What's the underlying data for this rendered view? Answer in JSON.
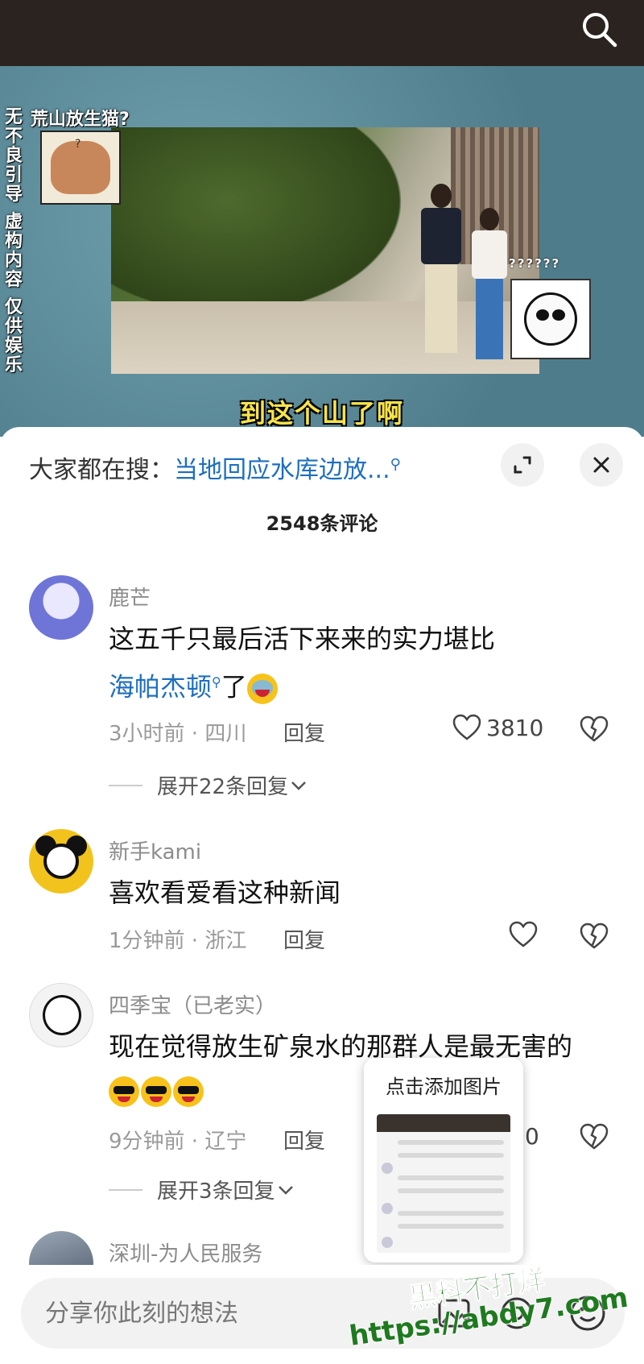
{
  "video": {
    "side_caption": [
      "无不良引导",
      "虚构内容",
      "仅供娱乐"
    ],
    "meme_label": "荒山放生猫?",
    "sticker_marks": "??????",
    "subtitle": "到这个山了啊"
  },
  "sheet": {
    "search_prefix": "大家都在搜：",
    "search_keyword": "当地回应水库边放...",
    "comment_count": "2548条评论"
  },
  "comments": [
    {
      "name": "鹿芒",
      "text_line1": "这五千只最后活下来来的实力堪比",
      "tag": "海帕杰顿",
      "text_tail": "了",
      "meta": "3小时前 · 四川",
      "reply": "回复",
      "likes": "3810",
      "expand": "展开22条回复"
    },
    {
      "name": "新手kami",
      "text_line1": "喜欢看爱看这种新闻",
      "meta": "1分钟前 · 浙江",
      "reply": "回复"
    },
    {
      "name": "四季宝（已老实）",
      "text_line1": "现在觉得放生矿泉水的那群人是最无害的",
      "meta": "9分钟前 · 辽宁",
      "reply": "回复",
      "likes_partial": "0",
      "expand": "展开3条回复"
    },
    {
      "name": "深圳-为人民服务"
    }
  ],
  "popup": {
    "title": "点击添加图片"
  },
  "input": {
    "placeholder": "分享你此刻的想法"
  },
  "watermark": {
    "line1": "黑料不打烊",
    "line2": "https://abdy7.com"
  },
  "colors": {
    "link": "#1e6ec0",
    "subtitle": "#f7e34b",
    "watermark": "#1f7a1f"
  }
}
